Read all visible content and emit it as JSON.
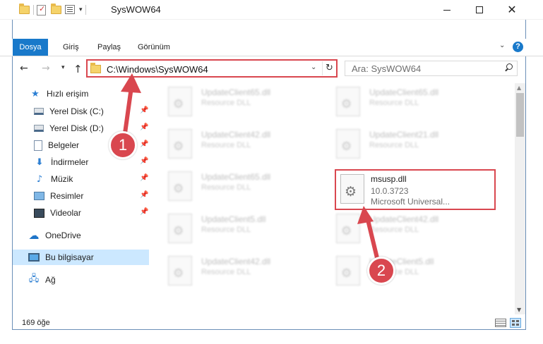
{
  "window": {
    "title": "SysWOW64",
    "qat_dropdown": "▾"
  },
  "ribbon": {
    "tabs": [
      "Dosya",
      "Giriş",
      "Paylaş",
      "Görünüm"
    ],
    "help": "?",
    "accent": "#1979ca"
  },
  "address_bar": {
    "path": "C:\\Windows\\SysWOW64",
    "highlight_color": "#d9474f"
  },
  "search": {
    "placeholder": "Ara: SysWOW64"
  },
  "sidebar": {
    "quick_access": "Hızlı erişim",
    "items": [
      {
        "label": "Yerel Disk (C:)",
        "icon": "disk-icon",
        "pinned": true
      },
      {
        "label": "Yerel Disk (D:)",
        "icon": "disk-icon",
        "pinned": true
      },
      {
        "label": "Belgeler",
        "icon": "document-icon",
        "pinned": true
      },
      {
        "label": "İndirmeler",
        "icon": "download-icon",
        "pinned": true
      },
      {
        "label": "Müzik",
        "icon": "music-icon",
        "pinned": true
      },
      {
        "label": "Resimler",
        "icon": "pictures-icon",
        "pinned": true
      },
      {
        "label": "Videolar",
        "icon": "video-icon",
        "pinned": true
      }
    ],
    "onedrive": "OneDrive",
    "this_pc": "Bu bilgisayar",
    "network": "Ağ"
  },
  "files": [
    {
      "name": "UpdateClient65.dll",
      "sub": "Resource DLL"
    },
    {
      "name": "UpdateClient65.dll",
      "sub": "Resource DLL"
    },
    {
      "name": "UpdateClient42.dll",
      "sub": "Resource DLL"
    },
    {
      "name": "UpdateClient21.dll",
      "sub": "Resource DLL"
    },
    {
      "name": "UpdateClient65.dll",
      "sub": "Resource DLL"
    },
    {
      "name": "UpdateClient5.dll",
      "sub": "Resource DLL"
    },
    {
      "name": "UpdateClient42.dll",
      "sub": "Resource DLL"
    },
    {
      "name": "UpdateClient42.dll",
      "sub": "Resource DLL"
    },
    {
      "name": "UpdateClient5.dll",
      "sub": "Resource DLL"
    }
  ],
  "focused_file": {
    "name": "msusp.dll",
    "version": "10.0.3723",
    "description": "Microsoft Universal..."
  },
  "status": {
    "item_count": "169 öğe"
  },
  "annotations": {
    "step1": "1",
    "step2": "2",
    "color": "#d9474f"
  }
}
